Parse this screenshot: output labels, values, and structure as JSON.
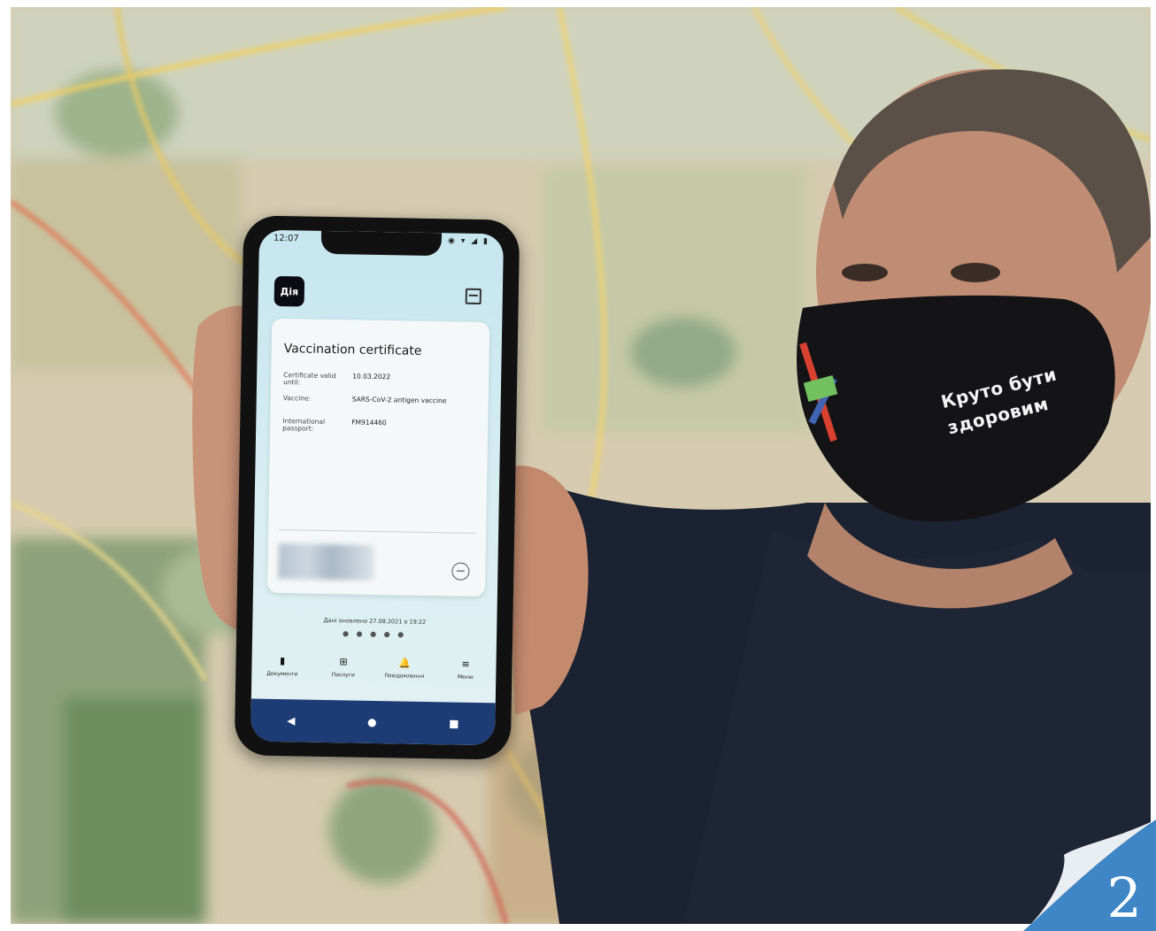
{
  "phone": {
    "status_time": "12:07",
    "status_icons": "◉ ▾ ◢ ▮",
    "app_logo": "Дія",
    "card_title": "Vaccination certificate",
    "fields": [
      {
        "label": "Certificate valid until:",
        "value": "10.03.2022"
      },
      {
        "label": "Vaccine:",
        "value": "SARS-CoV-2 antigen vaccine"
      },
      {
        "label": "International passport:",
        "value": "FM914460"
      }
    ],
    "minus_icon": "−",
    "updated_text": "Дані оновлено 27.08.2021 о 19:22",
    "page_dots": "● ● ● ● ●",
    "tabs": [
      {
        "icon": "▮",
        "label": "Документи"
      },
      {
        "icon": "⊞",
        "label": "Послуги"
      },
      {
        "icon": "🔔",
        "label": "Повідомлення"
      },
      {
        "icon": "≡",
        "label": "Меню"
      }
    ],
    "nav": {
      "back": "◀",
      "home": "●",
      "recents": "■"
    }
  },
  "mask": {
    "line1": "Круто бути",
    "line2": "здоровим"
  },
  "page_number": "2",
  "colors": {
    "screen_bg": "#cde9f0",
    "navbar": "#1d3b74",
    "page_curl": "#3f86c6"
  }
}
